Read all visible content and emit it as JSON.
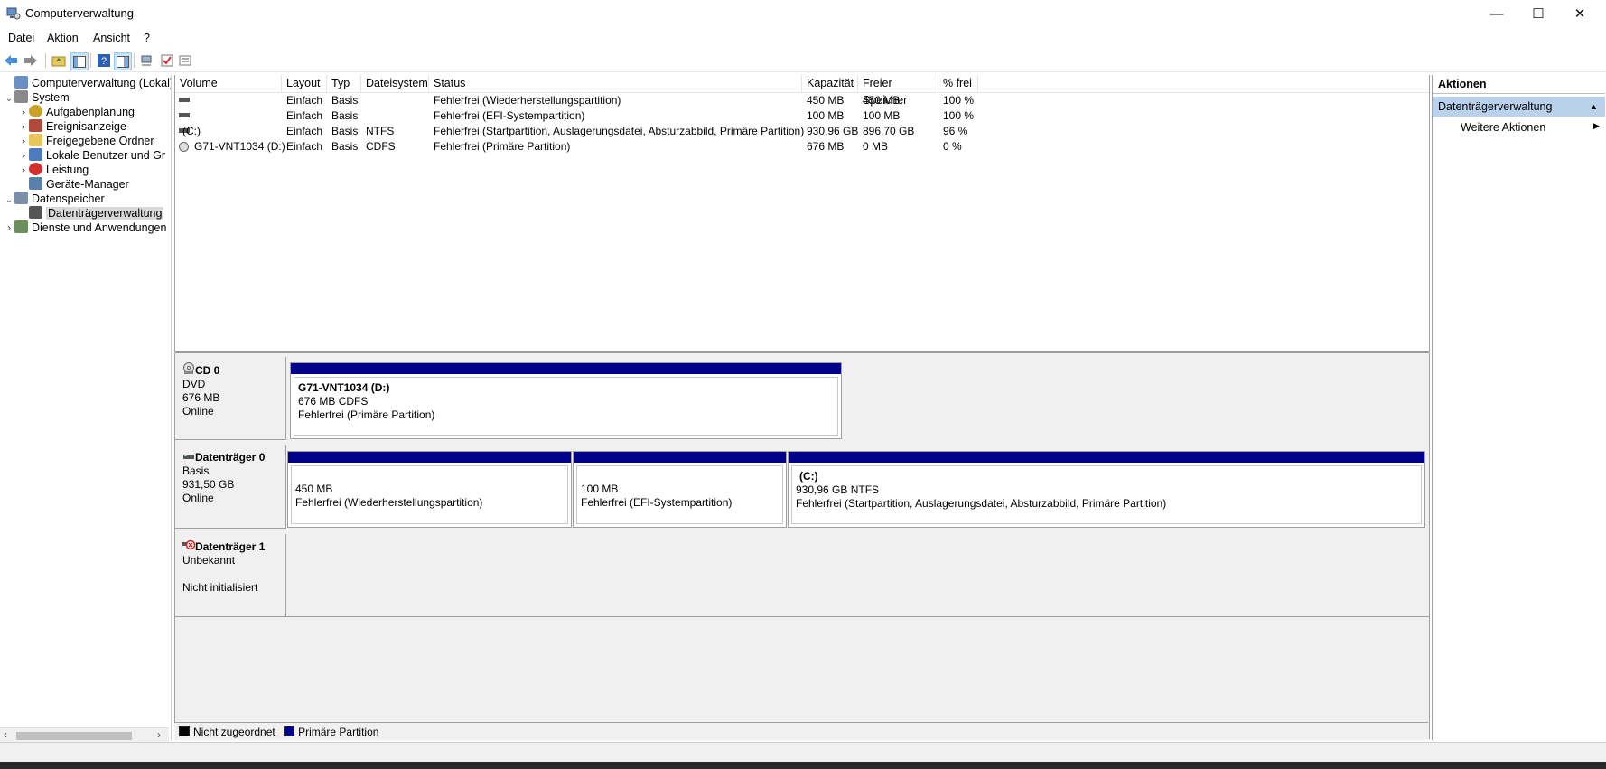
{
  "window": {
    "title": "Computerverwaltung",
    "controls": {
      "minimize": "—",
      "maximize": "☐",
      "close": "✕"
    }
  },
  "menu": {
    "items": [
      "Datei",
      "Aktion",
      "Ansicht",
      "?"
    ]
  },
  "tree": {
    "items": [
      {
        "label": "Computerverwaltung (Lokal)",
        "icon": "computer-management-icon",
        "level": 0,
        "expander": ""
      },
      {
        "label": "System",
        "icon": "system-tools-icon",
        "level": 0,
        "expander": "expanded"
      },
      {
        "label": "Aufgabenplanung",
        "icon": "clock-icon",
        "level": 1,
        "expander": "collapsed"
      },
      {
        "label": "Ereignisanzeige",
        "icon": "event-viewer-icon",
        "level": 1,
        "expander": "collapsed"
      },
      {
        "label": "Freigegebene Ordner",
        "icon": "shared-folder-icon",
        "level": 1,
        "expander": "collapsed"
      },
      {
        "label": "Lokale Benutzer und Gr",
        "icon": "users-icon",
        "level": 1,
        "expander": "collapsed"
      },
      {
        "label": "Leistung",
        "icon": "performance-icon",
        "level": 1,
        "expander": "collapsed"
      },
      {
        "label": "Geräte-Manager",
        "icon": "device-manager-icon",
        "level": 1,
        "expander": ""
      },
      {
        "label": "Datenspeicher",
        "icon": "storage-icon",
        "level": 0,
        "expander": "expanded"
      },
      {
        "label": "Datenträgerverwaltung",
        "icon": "disk-management-icon",
        "level": 1,
        "expander": "",
        "selected": true
      },
      {
        "label": "Dienste und Anwendungen",
        "icon": "services-icon",
        "level": 0,
        "expander": "collapsed"
      }
    ]
  },
  "volumes": {
    "columns": [
      "Volume",
      "Layout",
      "Typ",
      "Dateisystem",
      "Status",
      "Kapazität",
      "Freier Speicher",
      "% frei"
    ],
    "rows": [
      {
        "volume": "",
        "icon": "disk-icon",
        "layout": "Einfach",
        "typ": "Basis",
        "fs": "",
        "status": "Fehlerfrei (Wiederherstellungspartition)",
        "cap": "450 MB",
        "free": "450 MB",
        "pct": "100 %"
      },
      {
        "volume": "",
        "icon": "disk-icon",
        "layout": "Einfach",
        "typ": "Basis",
        "fs": "",
        "status": "Fehlerfrei (EFI-Systempartition)",
        "cap": "100 MB",
        "free": "100 MB",
        "pct": "100 %"
      },
      {
        "volume": "(C:)",
        "icon": "disk-icon",
        "layout": "Einfach",
        "typ": "Basis",
        "fs": "NTFS",
        "status": "Fehlerfrei (Startpartition, Auslagerungsdatei, Absturzabbild, Primäre Partition)",
        "cap": "930,96 GB",
        "free": "896,70 GB",
        "pct": "96 %"
      },
      {
        "volume": "G71-VNT1034 (D:)",
        "icon": "cd-icon",
        "layout": "Einfach",
        "typ": "Basis",
        "fs": "CDFS",
        "status": "Fehlerfrei (Primäre Partition)",
        "cap": "676 MB",
        "free": "0 MB",
        "pct": "0 %"
      }
    ]
  },
  "disks": [
    {
      "name": "CD 0",
      "icon": "cd-icon",
      "type": "DVD",
      "size": "676 MB",
      "state": "Online",
      "partitions": [
        {
          "title": "G71-VNT1034  (D:)",
          "size": "676 MB CDFS",
          "status": "Fehlerfrei (Primäre Partition)"
        }
      ]
    },
    {
      "name": "Datenträger 0",
      "icon": "disk-icon",
      "type": "Basis",
      "size": "931,50 GB",
      "state": "Online",
      "partitions": [
        {
          "title": "",
          "size": "450 MB",
          "status": "Fehlerfrei (Wiederherstellungspartition)"
        },
        {
          "title": "",
          "size": "100 MB",
          "status": "Fehlerfrei (EFI-Systempartition)"
        },
        {
          "title": "(C:)",
          "size": "930,96 GB NTFS",
          "status": "Fehlerfrei (Startpartition, Auslagerungsdatei, Absturzabbild, Primäre Partition)"
        }
      ]
    },
    {
      "name": "Datenträger 1",
      "icon": "disk-error-icon",
      "type": "Unbekannt",
      "size": "",
      "state": "Nicht initialisiert",
      "partitions": []
    }
  ],
  "legend": [
    {
      "label": "Nicht zugeordnet",
      "color": "#000000"
    },
    {
      "label": "Primäre Partition",
      "color": "#00008b"
    }
  ],
  "actions": {
    "header": "Aktionen",
    "section": "Datenträgerverwaltung",
    "item": "Weitere Aktionen"
  },
  "colors": {
    "primary_partition": "#00008b",
    "selection": "#b9d1ea"
  }
}
